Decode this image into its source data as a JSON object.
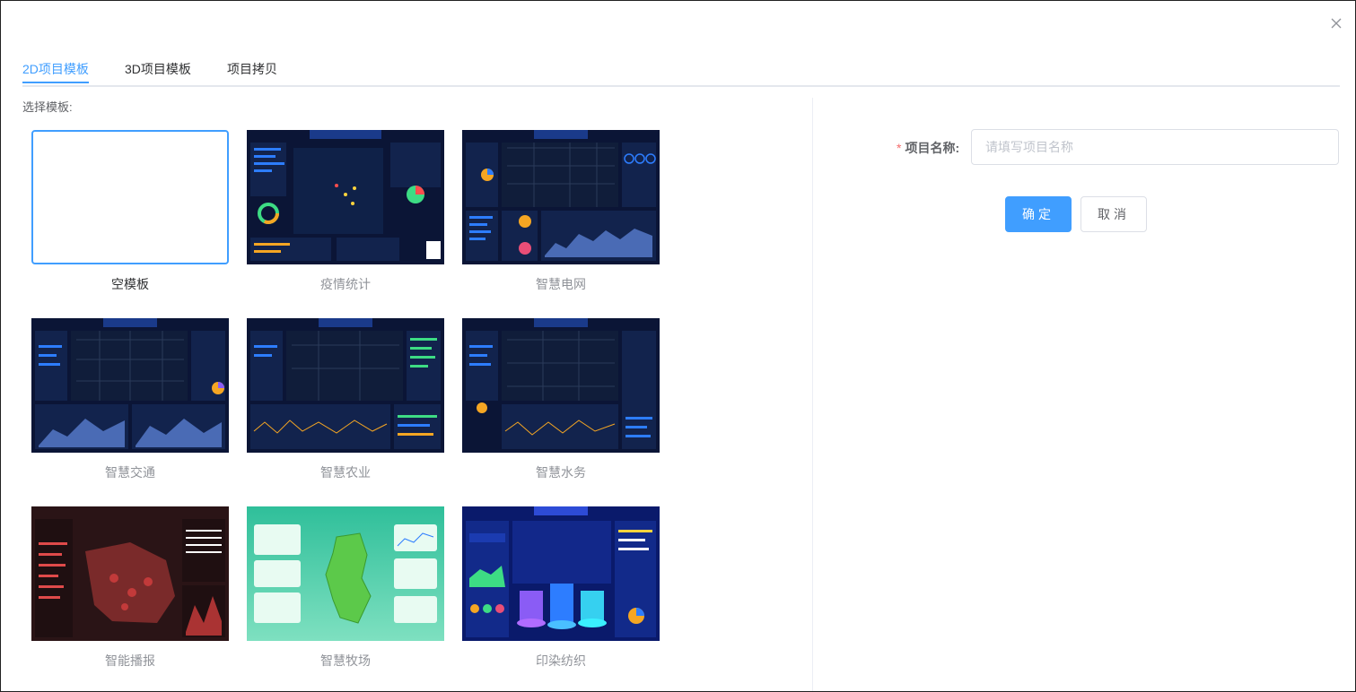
{
  "tabs": [
    {
      "label": "2D项目模板",
      "active": true
    },
    {
      "label": "3D项目模板",
      "active": false
    },
    {
      "label": "项目拷贝",
      "active": false
    }
  ],
  "choose_label": "选择模板:",
  "templates": [
    {
      "name": "空模板",
      "selected": true
    },
    {
      "name": "疫情统计",
      "selected": false
    },
    {
      "name": "智慧电网",
      "selected": false
    },
    {
      "name": "智慧交通",
      "selected": false
    },
    {
      "name": "智慧农业",
      "selected": false
    },
    {
      "name": "智慧水务",
      "selected": false
    },
    {
      "name": "智能播报",
      "selected": false
    },
    {
      "name": "智慧牧场",
      "selected": false
    },
    {
      "name": "印染纺织",
      "selected": false
    }
  ],
  "form": {
    "name_label": "项目名称:",
    "required_mark": "*",
    "name_placeholder": "请填写项目名称",
    "name_value": ""
  },
  "buttons": {
    "ok": "确定",
    "cancel": "取消"
  },
  "colors": {
    "accent": "#409eff",
    "dark_bg": "#0b1536",
    "red_bg": "#2a1416",
    "green_bg": "#3ec9a0",
    "blue_bg": "#0a1a6b"
  }
}
